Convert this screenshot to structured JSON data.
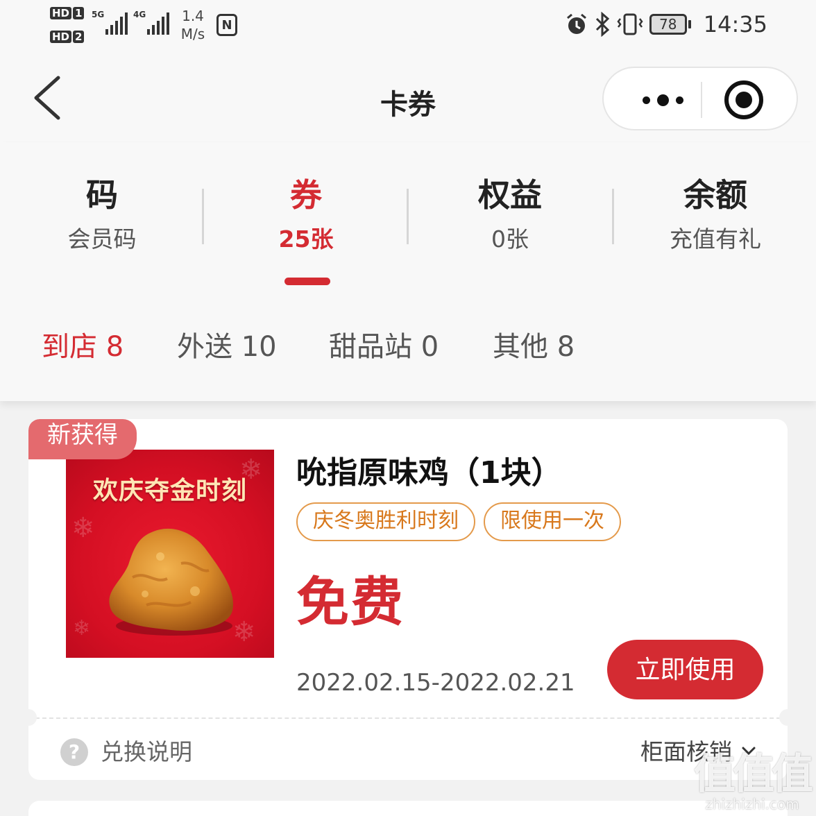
{
  "status_bar": {
    "hd1": "HD",
    "hd1_index": "1",
    "hd2": "HD",
    "hd2_index": "2",
    "net1": "5G",
    "net2": "4G",
    "speed_value": "1.4",
    "speed_unit": "M/s",
    "nfc_icon": "nfc-icon",
    "battery": "78",
    "time": "14:35"
  },
  "nav": {
    "title": "卡券",
    "back_icon": "chevron-left-icon",
    "more_icon": "more-dots-icon",
    "close_icon": "target-close-icon"
  },
  "main_tabs": [
    {
      "title": "码",
      "subtitle": "会员码",
      "active": false
    },
    {
      "title": "券",
      "subtitle": "25张",
      "active": true
    },
    {
      "title": "权益",
      "subtitle": "0张",
      "active": false
    },
    {
      "title": "余额",
      "subtitle": "充值有礼",
      "active": false
    }
  ],
  "sub_tabs": [
    {
      "label": "到店 8",
      "active": true
    },
    {
      "label": "外送 10",
      "active": false
    },
    {
      "label": "甜品站 0",
      "active": false
    },
    {
      "label": "其他 8",
      "active": false
    }
  ],
  "coupon": {
    "badge": "新获得",
    "image_caption": "欢庆夺金时刻",
    "title": "吮指原味鸡（1块）",
    "tags": [
      "庆冬奥胜利时刻",
      "限使用一次"
    ],
    "price": "免费",
    "validity": "2022.02.15-2022.02.21",
    "use_button": "立即使用",
    "help_label": "兑换说明",
    "help_icon_glyph": "?",
    "redeem_method": "柜面核销"
  },
  "watermark": {
    "logo": "值值值",
    "site": "zhizhizhi.com"
  },
  "colors": {
    "accent_red": "#d42b32",
    "tag_orange": "#d8781c",
    "badge_pink": "#e46a6e"
  }
}
